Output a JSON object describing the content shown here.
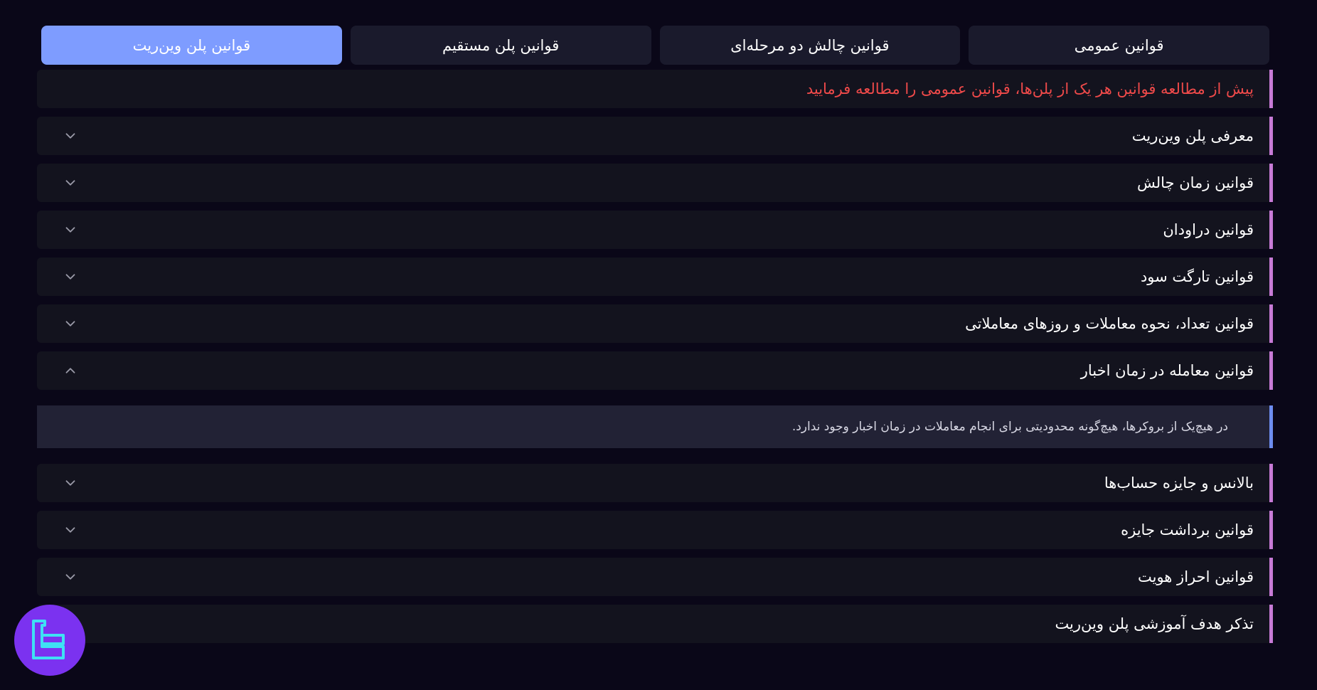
{
  "tabs": [
    {
      "label": "قوانین عمومی",
      "active": false
    },
    {
      "label": "قوانین چالش دو مرحله‌ای",
      "active": false
    },
    {
      "label": "قوانین پلن مستقیم",
      "active": false
    },
    {
      "label": "قوانین پلن وین‌ریت",
      "active": true
    }
  ],
  "notice": "پیش از مطالعه قوانین هر یک از پلن‌ها، قوانین عمومی را مطالعه فرمایید",
  "sections_before": [
    {
      "label": "معرفی پلن وین‌ریت",
      "icon": "chevron-down-icon"
    },
    {
      "label": "قوانین زمان چالش",
      "icon": "chevron-down-icon"
    },
    {
      "label": "قوانین دراودان",
      "icon": "chevron-down-icon"
    },
    {
      "label": "قوانین تارگت سود",
      "icon": "chevron-down-icon"
    },
    {
      "label": "قوانین تعداد، نحوه معاملات و روزهای معاملاتی",
      "icon": "chevron-down-icon"
    }
  ],
  "expanded_section": {
    "label": "قوانین معامله در زمان اخبار",
    "icon": "chevron-up-icon",
    "content": "در هیچ‌یک از بروکرها، هیچ‌گونه محدودیتی برای انجام معاملات در زمان اخبار وجود ندارد."
  },
  "sections_after": [
    {
      "label": "بالانس و جایزه حساب‌ها",
      "icon": "chevron-down-icon"
    },
    {
      "label": "قوانین برداشت جایزه",
      "icon": "chevron-down-icon"
    },
    {
      "label": "قوانین احراز هویت",
      "icon": "chevron-down-icon"
    },
    {
      "label": "تذکر هدف آموزشی پلن وین‌ریت",
      "icon": "chevron-down-icon"
    }
  ],
  "colors": {
    "background": "#0a0718",
    "row": "#13131e",
    "tab_active": "#7e9cff",
    "accent_border": "#c77ad6",
    "panel_border": "#6d8cf0",
    "notice_text": "#f04a4a",
    "logo": "#7b32f0"
  },
  "logo": {
    "icon": "brand-logo-icon"
  }
}
